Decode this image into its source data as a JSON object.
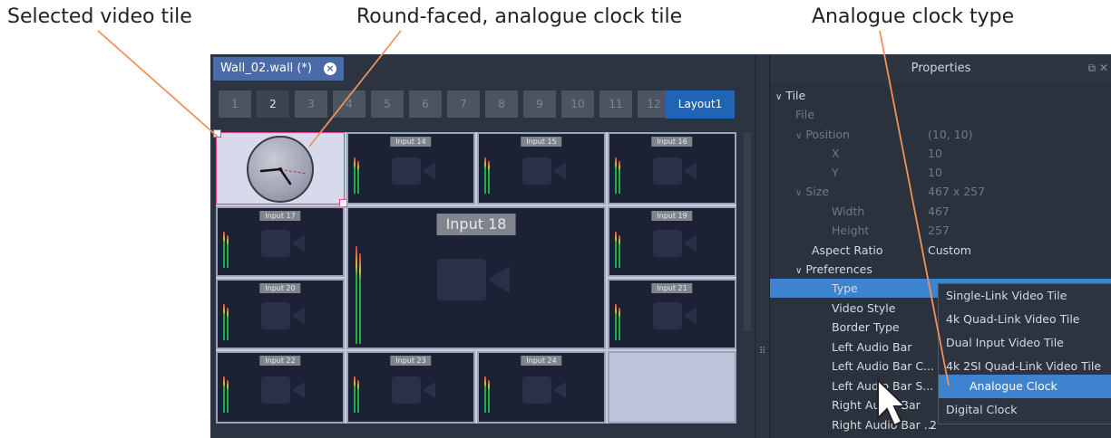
{
  "callouts": {
    "selected_tile": "Selected video tile",
    "clock_tile": "Round-faced, analogue clock tile",
    "clock_type": "Analogue clock type"
  },
  "editor": {
    "tab_label": "Wall_02.wall (*)",
    "layout_buttons": [
      "1",
      "2",
      "3",
      "4",
      "5",
      "6",
      "7",
      "8",
      "9",
      "10",
      "11",
      "12"
    ],
    "active_layout": "2",
    "layout_name": "Layout1"
  },
  "tiles": [
    {
      "label": "Input 14"
    },
    {
      "label": "Input 15"
    },
    {
      "label": "Input 16"
    },
    {
      "label": "Input 17"
    },
    {
      "label": "Input 18"
    },
    {
      "label": "Input 19"
    },
    {
      "label": "Input 20"
    },
    {
      "label": "Input 21"
    },
    {
      "label": "Input 22"
    },
    {
      "label": "Input 23"
    },
    {
      "label": "Input 24"
    }
  ],
  "properties": {
    "title": "Properties",
    "tile": "Tile",
    "file": "File",
    "position": "Position",
    "position_value": "(10, 10)",
    "x": "X",
    "x_value": "10",
    "y": "Y",
    "y_value": "10",
    "size": "Size",
    "size_value": "467 x 257",
    "width": "Width",
    "width_value": "467",
    "height": "Height",
    "height_value": "257",
    "aspect_ratio": "Aspect Ratio",
    "aspect_ratio_value": "Custom",
    "preferences": "Preferences",
    "type": "Type",
    "video_style": "Video Style",
    "border_type": "Border Type",
    "left_audio_bar": "Left Audio Bar",
    "left_audio_bar_c": "Left Audio Bar C...",
    "left_audio_bar_s": "Left Audio Bar S...",
    "right_audio_bar": "Right Audio Bar",
    "right_audio_bar_more": "Right Audio Bar ...",
    "right_audio_bar_more_value": "2"
  },
  "type_options": [
    "Single-Link Video Tile",
    "4k Quad-Link Video Tile",
    "Dual Input Video Tile",
    "4k 2SI Quad-Link Video Tile",
    "Analogue Clock",
    "Digital Clock"
  ],
  "selected_type": "Analogue Clock",
  "colors": {
    "accent": "#3e83cf",
    "panel": "#2b3440",
    "selection_border": "#e83e8c",
    "callout_line": "#f0915a"
  }
}
